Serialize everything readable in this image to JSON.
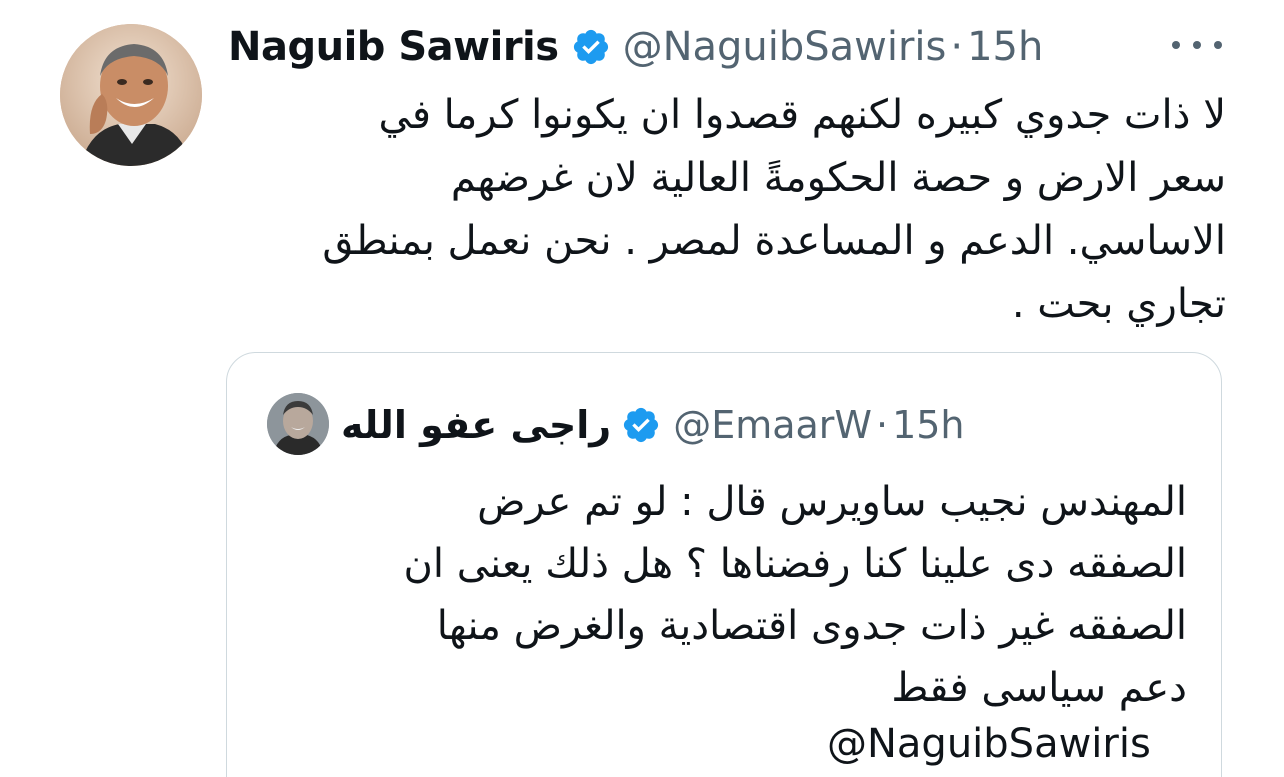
{
  "author": {
    "name": "Naguib Sawiris",
    "handle": "@NaguibSawiris",
    "time": "15h",
    "separator": "·",
    "verified_icon": "verified-badge-icon",
    "verified_color": "#1d9bf0"
  },
  "menu": {
    "icon": "more-options-icon"
  },
  "tweet": {
    "text": "لا ذات جدوي كبيره لكنهم قصدوا ان يكونوا كرما في\nسعر الارض و حصة الحكومةً العالية لان غرضهم\nالاساسي. الدعم و المساعدة لمصر . نحن نعمل بمنطق\nتجاري بحت ."
  },
  "quoted_tweet": {
    "name": "راجى عفو الله",
    "handle": "@EmaarW",
    "time": "15h",
    "separator": "·",
    "verified_icon": "verified-badge-icon",
    "text": "المهندس نجيب ساويرس قال : لو تم عرض\nالصفقه دى علينا كنا رفضناها ؟ هل ذلك يعنى ان\nالصفقه غير ذات جدوى اقتصادية والغرض منها\nدعم سياسى فقط",
    "mention": "@NaguibSawiris"
  },
  "colors": {
    "text_primary": "#0f1419",
    "text_secondary": "#536471",
    "border": "#cfd9de",
    "accent": "#1d9bf0"
  }
}
